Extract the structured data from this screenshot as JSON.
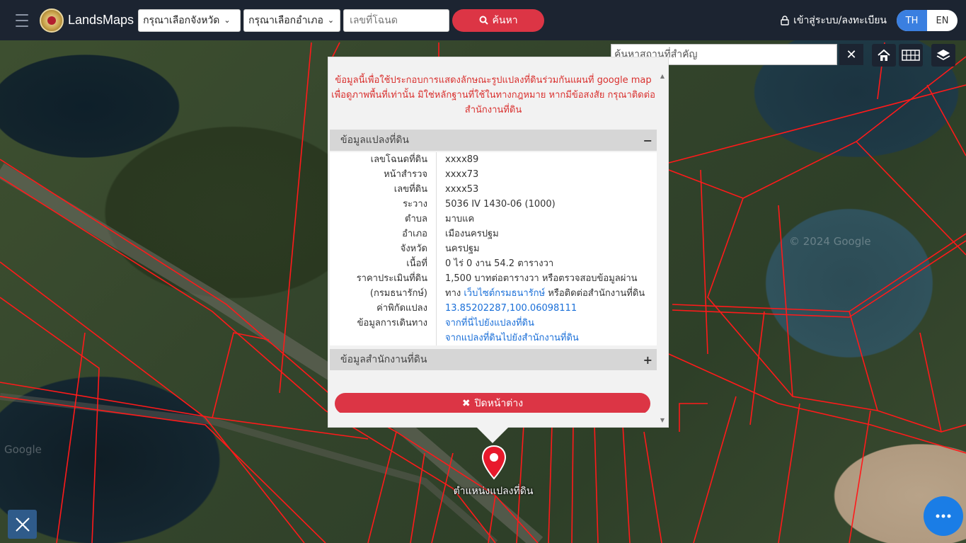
{
  "navbar": {
    "brand": "LandsMaps",
    "province_select": "กรุณาเลือกจังหวัด",
    "district_select": "กรุณาเลือกอำเภอ",
    "parcel_placeholder": "เลขที่โฉนด",
    "search_label": "ค้นหา",
    "login_label": "เข้าสู่ระบบ/ลงทะเบียน",
    "lang_th": "TH",
    "lang_en": "EN"
  },
  "place_search": {
    "placeholder": "ค้นหาสถานที่สำคัญ",
    "clear": "✕"
  },
  "popup": {
    "disclaimer": "ข้อมูลนี้เพื่อใช้ประกอบการแสดงลักษณะรูปแปลงที่ดินร่วมกันแผนที่ google map เพื่อดูภาพพื้นที่เท่านั้น มิใช่หลักฐานที่ใช้ในทางกฎหมาย หากมีข้อสงสัย กรุณาติดต่อสำนักงานที่ดิน",
    "section_land": "ข้อมูลแปลงที่ดิน",
    "section_land_toggle": "−",
    "section_office": "ข้อมูลสำนักงานที่ดิน",
    "section_office_toggle": "+",
    "rows": [
      {
        "k": "เลขโฉนดที่ดิน",
        "v": "xxxx89"
      },
      {
        "k": "หน้าสำรวจ",
        "v": "xxxx73"
      },
      {
        "k": "เลขที่ดิน",
        "v": "xxxx53"
      },
      {
        "k": "ระวาง",
        "v": "5036 IV 1430-06 (1000)"
      },
      {
        "k": "ตำบล",
        "v": "มาบแค"
      },
      {
        "k": "อำเภอ",
        "v": "เมืองนครปฐม"
      },
      {
        "k": "จังหวัด",
        "v": "นครปฐม"
      },
      {
        "k": "เนื้อที่",
        "v": "0 ไร่ 0 งาน 54.2 ตารางวา"
      }
    ],
    "price_k1": "ราคาประเมินที่ดิน",
    "price_k2": "(กรมธนารักษ์)",
    "price_v1": "1,500 บาทต่อตารางวา หรือตรวจสอบข้อมูลผ่าน",
    "price_v2a": "ทาง",
    "price_link": "เว็บไซต์กรมธนารักษ์",
    "price_v2b": "หรือติดต่อสำนักงานที่ดิน",
    "coord_k": "ค่าพิกัดแปลง",
    "coord_v": "13.85202287,100.06098111",
    "travel_k": "ข้อมูลการเดินทาง",
    "travel_link1": "จากที่นี่ไปยังแปลงที่ดิน",
    "travel_link2": "จากแปลงที่ดินไปยังสำนักงานที่ดิน",
    "close_label": "ปิดหน้าต่าง"
  },
  "marker_label": "ตำแหน่งแปลงที่ดิน",
  "watermarks": [
    "© 2024 Google",
    "Google"
  ],
  "colors": {
    "navbar": "#1c2431",
    "accent_red": "#dc3545",
    "lang_active": "#3a7fe0",
    "parcel_lines": "#ff1a1a",
    "chat": "#1a7de6"
  }
}
